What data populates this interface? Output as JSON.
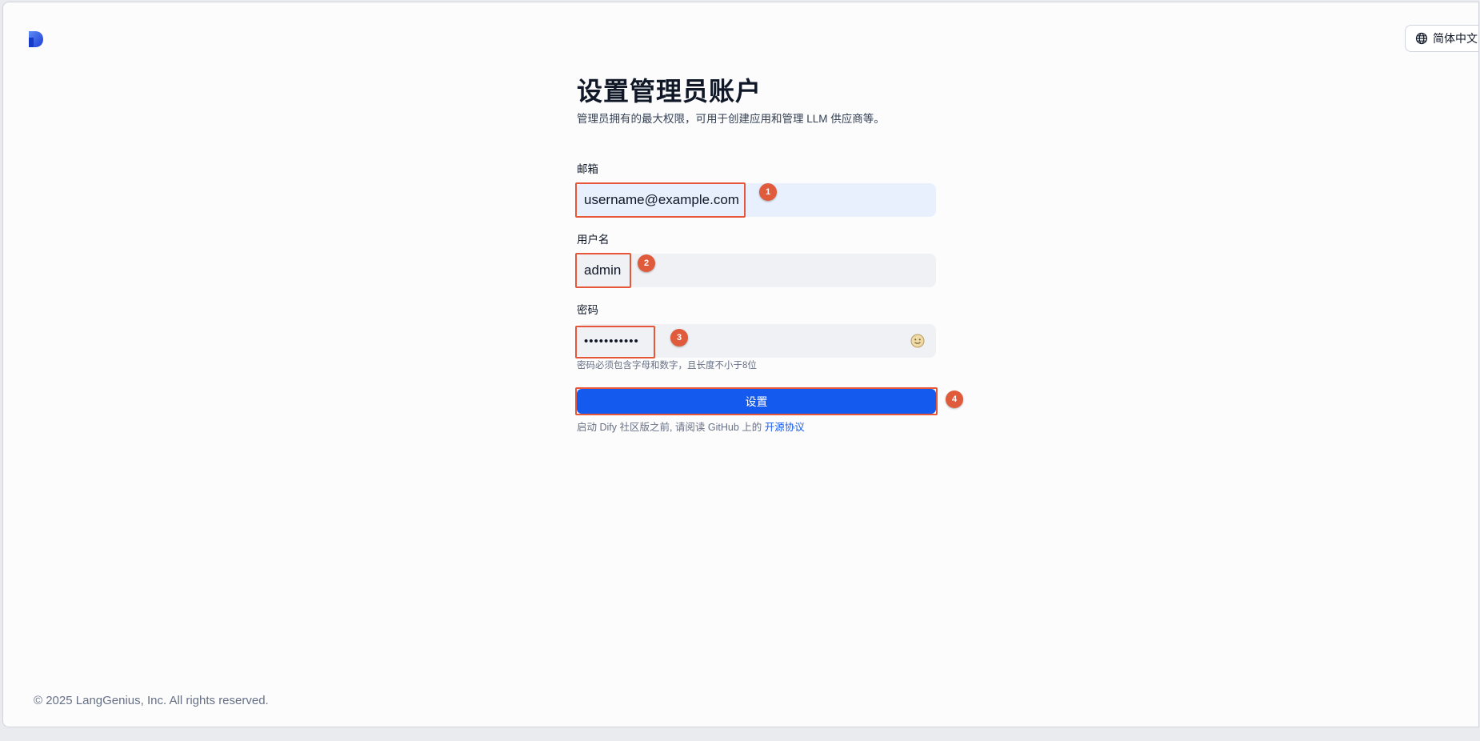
{
  "header": {
    "language_label": "简体中文"
  },
  "page": {
    "title": "设置管理员账户",
    "subtitle": "管理员拥有的最大权限，可用于创建应用和管理 LLM 供应商等。"
  },
  "form": {
    "email_label": "邮箱",
    "email_value": "username@example.com",
    "username_label": "用户名",
    "username_value": "admin",
    "password_label": "密码",
    "password_value": "•••••••••••",
    "password_hint": "密码必须包含字母和数字，且长度不小于8位",
    "submit_label": "设置",
    "agreement_prefix": "启动 Dify 社区版之前, 请阅读 GitHub 上的 ",
    "agreement_link": "开源协议"
  },
  "annotations": {
    "b1": "1",
    "b2": "2",
    "b3": "3",
    "b4": "4"
  },
  "footer": {
    "copyright": "© 2025 LangGenius, Inc. All rights reserved."
  },
  "colors": {
    "accent": "#155aef",
    "annotation": "#e8563a"
  }
}
